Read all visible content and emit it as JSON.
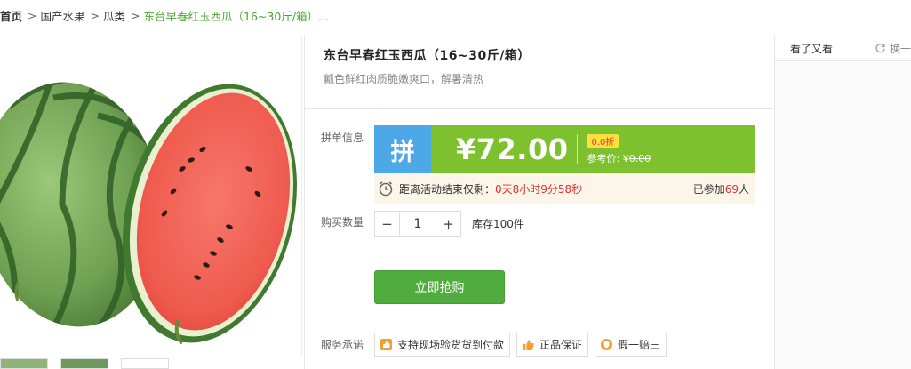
{
  "breadcrumb": {
    "home": "首页",
    "items": [
      "国产水果",
      "瓜类"
    ],
    "current": "东台早春红玉西瓜（16~30斤/箱）..."
  },
  "product": {
    "title": "东台早春红玉西瓜（16~30斤/箱）",
    "subtitle": "瓤色鲜红肉质脆嫩爽口，解暑清热"
  },
  "group_buy": {
    "label": "拼单信息",
    "tag": "拼",
    "price": "¥72.00",
    "discount": "0.0折",
    "ref_label": "参考价:",
    "ref_currency": "¥",
    "ref_value": "0.00",
    "countdown_label": "距离活动结束仅剩：",
    "countdown_time": "0天8小时9分58秒",
    "joined_prefix": "已参加",
    "joined_count": "69",
    "joined_suffix": "人"
  },
  "quantity": {
    "label": "购买数量",
    "minus": "−",
    "value": "1",
    "plus": "+",
    "stock": "库存100件"
  },
  "buy_button": "立即抢购",
  "service": {
    "label": "服务承诺",
    "items": [
      {
        "icon": "thumb-cod-icon",
        "text": "支持现场验货货到付款"
      },
      {
        "icon": "thumb-up-icon",
        "text": "正品保证"
      },
      {
        "icon": "shield-icon",
        "text": "假一赔三"
      }
    ]
  },
  "right_panel": {
    "title": "看了又看",
    "refresh": "换一批"
  },
  "colors": {
    "accent_green": "#50ad3d",
    "price_green": "#7ec12f",
    "pin_blue": "#4da8e8",
    "alert_red": "#e0302a"
  }
}
